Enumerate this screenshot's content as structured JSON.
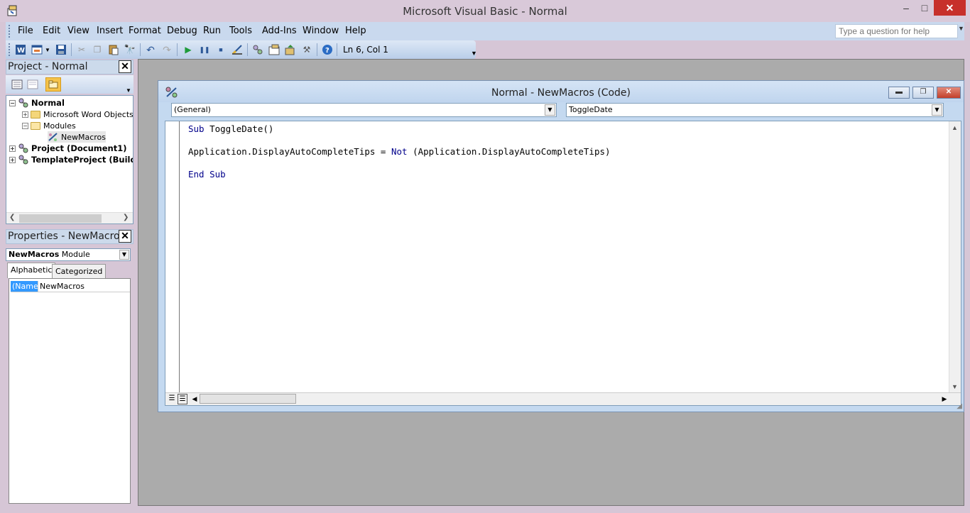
{
  "window": {
    "title": "Microsoft Visual Basic - Normal",
    "min": "–",
    "max": "□",
    "close": "✕"
  },
  "menu": {
    "items": [
      "File",
      "Edit",
      "View",
      "Insert",
      "Format",
      "Debug",
      "Run",
      "Tools",
      "Add-Ins",
      "Window",
      "Help"
    ],
    "help_placeholder": "Type a question for help"
  },
  "toolbar": {
    "position": "Ln 6, Col 1"
  },
  "project": {
    "title": "Project - Normal",
    "tree": {
      "normal": "Normal",
      "word_objects": "Microsoft Word Objects",
      "modules": "Modules",
      "newmacros": "NewMacros",
      "project_doc": "Project (Document1)",
      "template_project": "TemplateProject (Buildin"
    }
  },
  "properties": {
    "title": "Properties - NewMacros",
    "object_name": "NewMacros",
    "object_type": "Module",
    "tabs": [
      "Alphabetic",
      "Categorized"
    ],
    "rows": [
      {
        "name": "(Name)",
        "value": "NewMacros"
      }
    ]
  },
  "code_window": {
    "title": "Normal - NewMacros (Code)",
    "object_combo": "(General)",
    "proc_combo": "ToggleDate",
    "lines": {
      "l1_kw": "Sub",
      "l1_rest": " ToggleDate()",
      "l2_a": "Application.DisplayAutoCompleteTips = ",
      "l2_kw": "Not",
      "l2_b": " (Application.DisplayAutoCompleteTips)",
      "l3_kw": "End Sub"
    }
  },
  "colors": {
    "keyword": "#00008b",
    "selection": "#3399ff",
    "close_button": "#c7302b"
  }
}
